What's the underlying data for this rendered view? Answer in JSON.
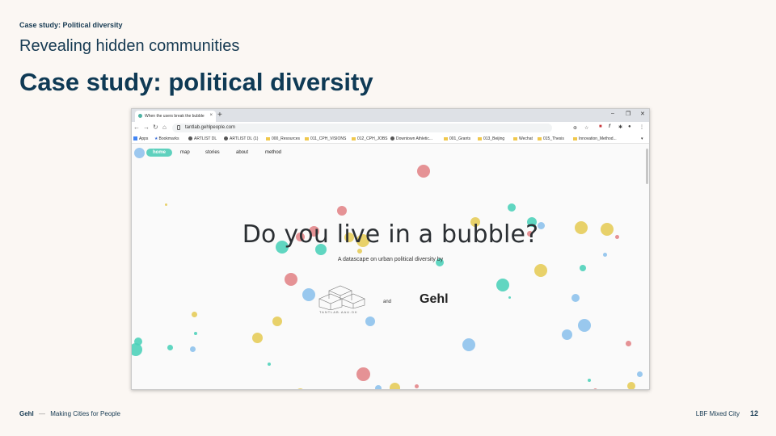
{
  "slide": {
    "kicker": "Case study: Political  diversity",
    "subtitle": "Revealing hidden communities",
    "title": "Case study: political diversity",
    "footer_brand": "Gehl",
    "footer_sep": "—",
    "footer_tagline": "Making Cities for People",
    "footer_right": "LBF Mixed City",
    "page_number": "12"
  },
  "browser": {
    "tab_title": "When the users break the bubble",
    "tab_close": "×",
    "new_tab": "+",
    "window_controls": [
      "–",
      "❐",
      "✕"
    ],
    "url": "tantlab.gehlpeople.com",
    "bookmarks": [
      {
        "label": "Apps",
        "icon": "apps-grid-icon"
      },
      {
        "label": "Bookmarks",
        "icon": "star-icon"
      },
      {
        "label": "ARTLIST DL",
        "icon": "globe-icon"
      },
      {
        "label": "ARTLIST DL (1)",
        "icon": "globe-icon"
      },
      {
        "label": "000_Resources",
        "icon": "folder-icon"
      },
      {
        "label": "011_CPH_VISIONS",
        "icon": "folder-icon"
      },
      {
        "label": "012_CPH_JOBS",
        "icon": "folder-icon"
      },
      {
        "label": "Downtown Athletic...",
        "icon": "globe-icon"
      },
      {
        "label": "001_Grants",
        "icon": "folder-icon"
      },
      {
        "label": "013_Beijing",
        "icon": "folder-icon"
      },
      {
        "label": "Wechat",
        "icon": "folder-icon"
      },
      {
        "label": "015_Thesis",
        "icon": "folder-icon"
      },
      {
        "label": "Innovation_Method...",
        "icon": "folder-icon"
      }
    ]
  },
  "website": {
    "nav": [
      "home",
      "map",
      "stories",
      "about",
      "method"
    ],
    "active_nav": "home",
    "headline": "Do you live in a bubble?",
    "tagline": "A datascape on urban political diversity by",
    "and_text": "and",
    "partner_logo_text": "Gehl",
    "tantlab_logo_text": "TANTLAB.AAU.DK"
  },
  "colors": {
    "teal": "#4fd1ba",
    "red": "#e2868a",
    "yellow": "#e6cc5a",
    "blue": "#8ec2ec",
    "nav_active": "#5fd1be",
    "title": "#0f3a55"
  }
}
